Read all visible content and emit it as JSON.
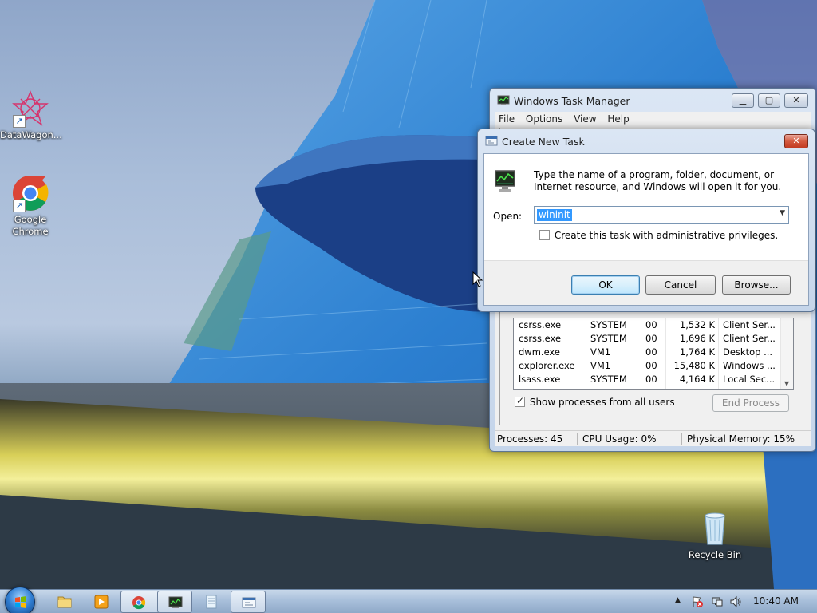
{
  "desktop": {
    "icons": [
      {
        "label": "DataWagon...",
        "icon": "datawagon-icon"
      },
      {
        "label": "Google Chrome",
        "icon": "chrome-icon"
      },
      {
        "label": "Recycle Bin",
        "icon": "recycle-bin-icon"
      }
    ]
  },
  "task_manager": {
    "title": "Windows Task Manager",
    "menu": [
      "File",
      "Options",
      "View",
      "Help"
    ],
    "processes": [
      {
        "name": "csrss.exe",
        "user": "SYSTEM",
        "cpu": "00",
        "mem": "1,532 K",
        "desc": "Client Ser..."
      },
      {
        "name": "csrss.exe",
        "user": "SYSTEM",
        "cpu": "00",
        "mem": "1,696 K",
        "desc": "Client Ser..."
      },
      {
        "name": "dwm.exe",
        "user": "VM1",
        "cpu": "00",
        "mem": "1,764 K",
        "desc": "Desktop ..."
      },
      {
        "name": "explorer.exe",
        "user": "VM1",
        "cpu": "00",
        "mem": "15,480 K",
        "desc": "Windows ..."
      },
      {
        "name": "lsass.exe",
        "user": "SYSTEM",
        "cpu": "00",
        "mem": "4,164 K",
        "desc": "Local Sec..."
      }
    ],
    "show_all_label": "Show processes from all users",
    "show_all_checked": true,
    "end_process_label": "End Process",
    "status": {
      "processes": "Processes: 45",
      "cpu": "CPU Usage: 0%",
      "memory": "Physical Memory: 15%"
    }
  },
  "create_task": {
    "title": "Create New Task",
    "description": "Type the name of a program, folder, document, or Internet resource, and Windows will open it for you.",
    "open_label": "Open:",
    "open_value": "wininit",
    "admin_label": "Create this task with administrative privileges.",
    "admin_checked": false,
    "ok_label": "OK",
    "cancel_label": "Cancel",
    "browse_label": "Browse..."
  },
  "taskbar": {
    "clock": "10:40 AM",
    "colors": {
      "accent": "#3399ff"
    }
  }
}
